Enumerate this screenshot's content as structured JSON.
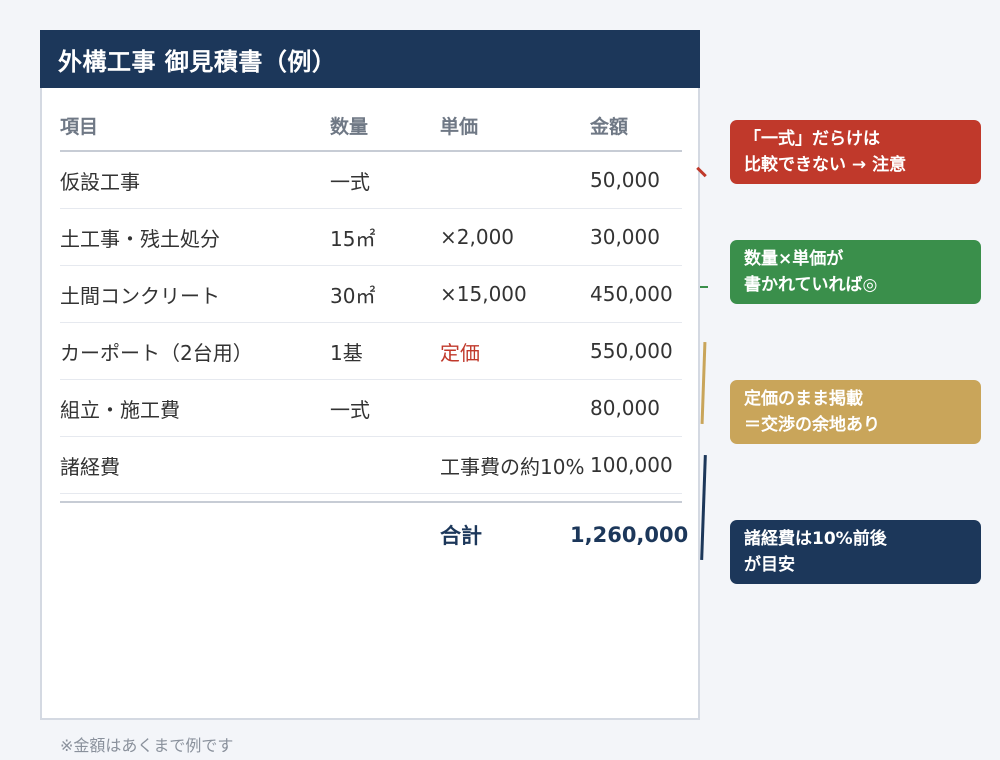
{
  "title": "外構工事 御見積書（例）",
  "columns": [
    "項目",
    "数量",
    "単価",
    "金額"
  ],
  "rows": [
    {
      "item": "仮設工事",
      "qty": "一式",
      "unit": "",
      "amount": "50,000"
    },
    {
      "item": "土工事・残土処分",
      "qty": "15㎡",
      "unit": "×2,000",
      "amount": "30,000"
    },
    {
      "item": "土間コンクリート",
      "qty": "30㎡",
      "unit": "×15,000",
      "amount": "450,000"
    },
    {
      "item": "カーポート（2台用）",
      "qty": "1基",
      "unit": "定価",
      "amount": "550,000"
    },
    {
      "item": "組立・施工費",
      "qty": "一式",
      "unit": "",
      "amount": "80,000"
    },
    {
      "item": "諸経費",
      "qty": "",
      "unit": "工事費の約10%",
      "amount": "100,000"
    }
  ],
  "total": {
    "label": "合計",
    "value": "1,260,000"
  },
  "callouts": [
    {
      "line1": "「一式」だらけは",
      "line2": "比較できない → 注意",
      "color": "#c0392b"
    },
    {
      "line1": "数量×単価が",
      "line2": "書かれていれば◎",
      "color": "#3a8f4b"
    },
    {
      "line1": "定価のまま掲載",
      "line2": "＝交渉の余地あり",
      "color": "#c9a55a"
    },
    {
      "line1": "諸経費は10%前後",
      "line2": "が目安",
      "color": "#1c375a"
    }
  ],
  "colors": {
    "header_bg": "#1c375a",
    "warning": "#c0392b",
    "good": "#3a8f4b",
    "gold": "#c9a55a",
    "navy": "#1c375a"
  },
  "footnote": "※金額はあくまで例です"
}
